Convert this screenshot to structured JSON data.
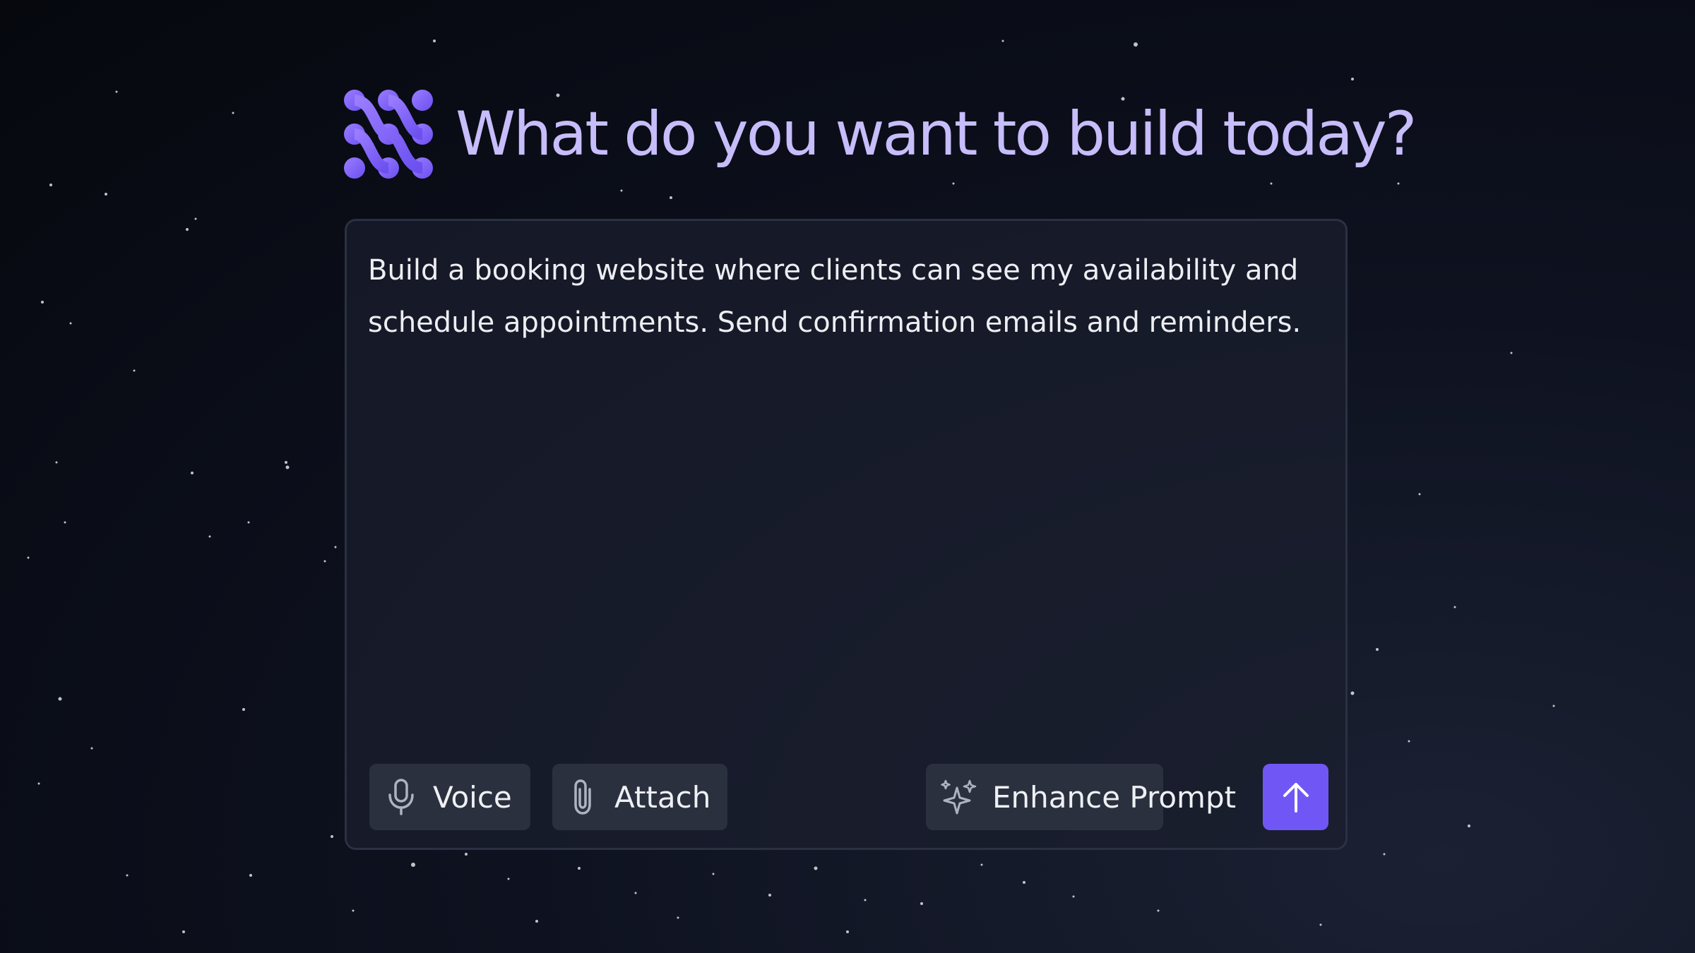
{
  "header": {
    "title": "What do you want to build today?",
    "logo_icon": "dotted-logo-icon",
    "title_color": "#c7bdfb"
  },
  "prompt": {
    "text": "Build a booking website where clients can see my availability and schedule appointments. Send confirmation emails and reminders."
  },
  "toolbar": {
    "voice_label": "Voice",
    "voice_icon": "microphone-icon",
    "attach_label": "Attach",
    "attach_icon": "paperclip-icon",
    "enhance_label": "Enhance Prompt",
    "enhance_icon": "sparkles-icon",
    "send_icon": "arrow-up-icon"
  },
  "colors": {
    "accent": "#7057f5",
    "button_bg": "#2b303f",
    "card_bg": "#1a1f2e"
  }
}
